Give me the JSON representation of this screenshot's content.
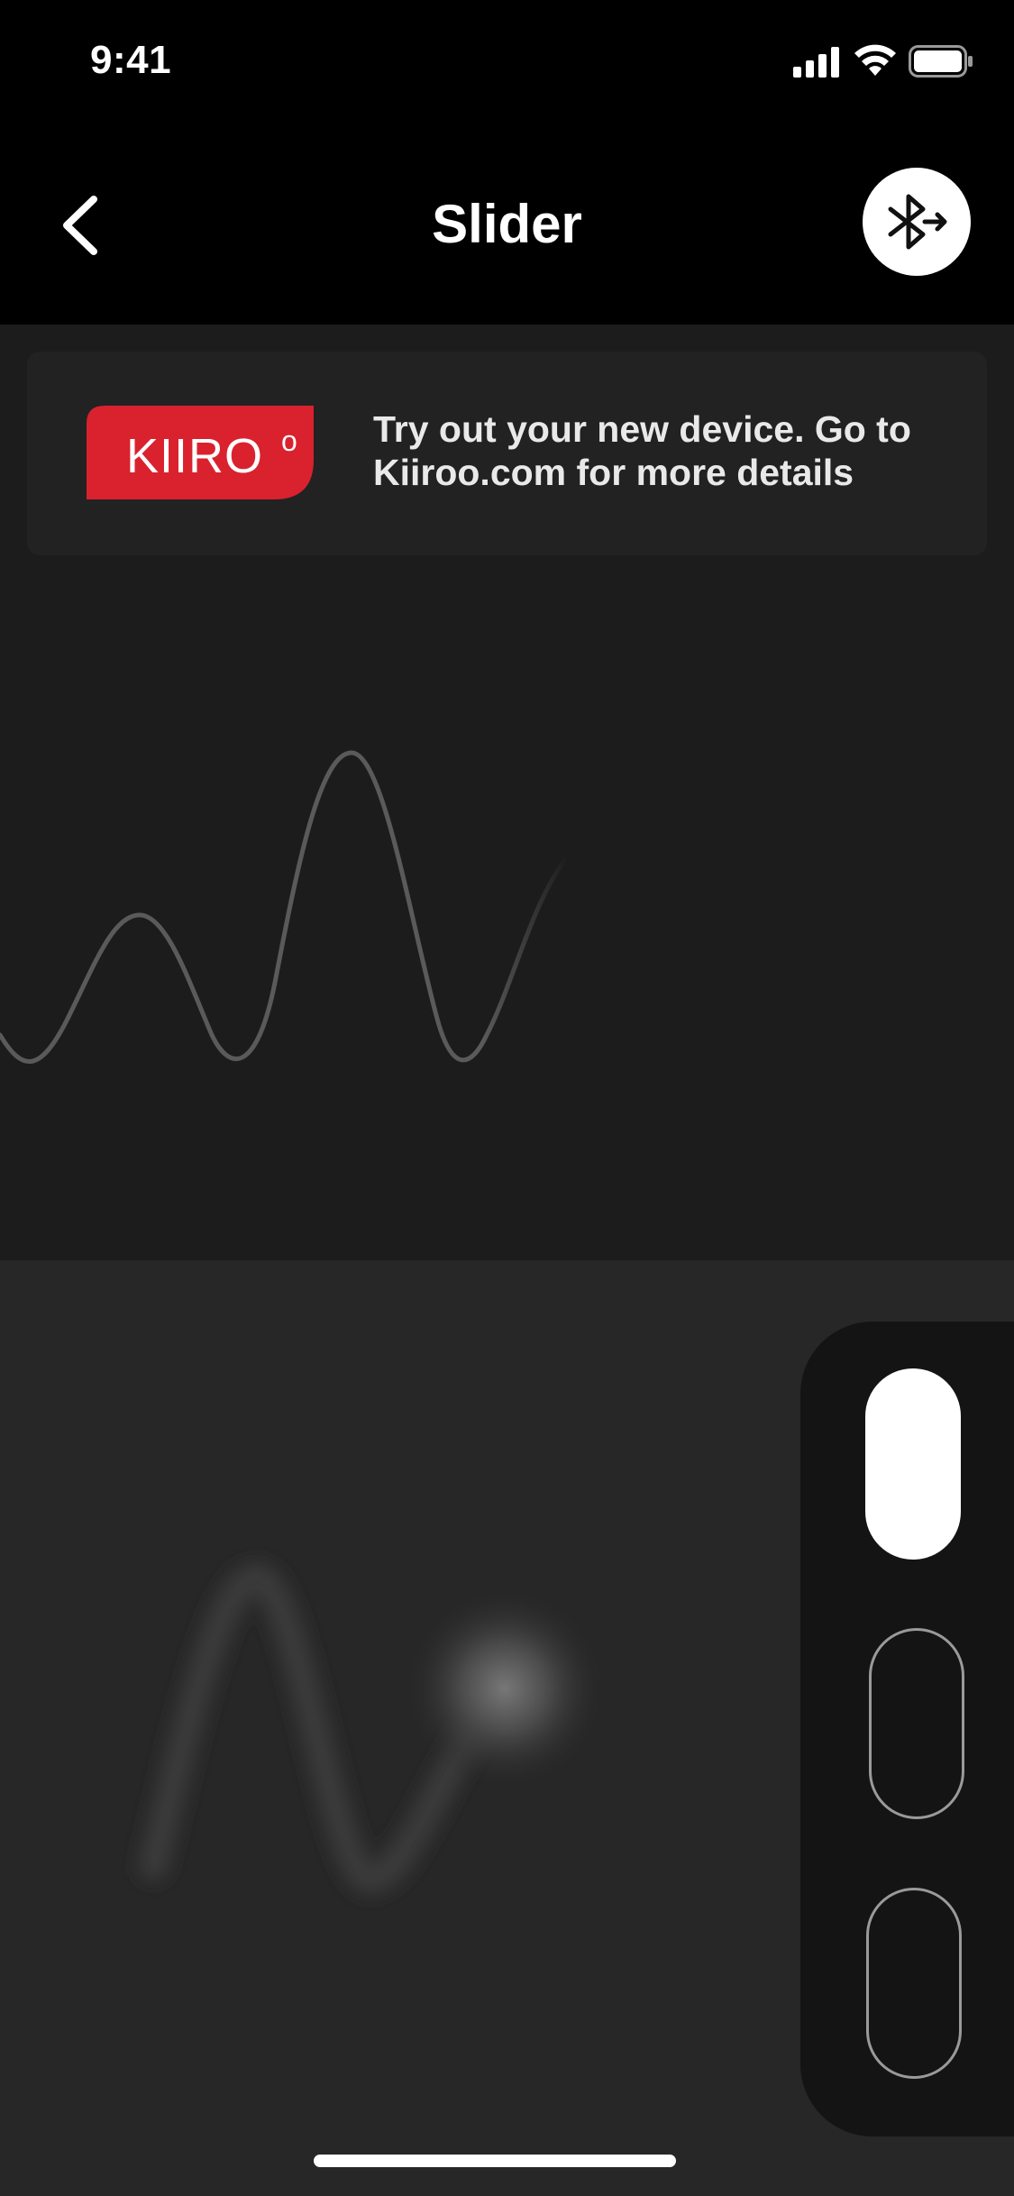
{
  "status_bar": {
    "time": "9:41"
  },
  "nav": {
    "title": "Slider",
    "back_icon": "chevron-left-icon",
    "bluetooth_icon": "bluetooth-arrow-icon"
  },
  "banner": {
    "logo_text": "KIIRO",
    "logo_superscript": "o",
    "message_line1": "Try out your new device. Go to",
    "message_line2": "Kiiroo.com for more details",
    "logo_color": "#d9222e"
  },
  "modes": [
    {
      "name": "mode-1",
      "selected": true
    },
    {
      "name": "mode-2",
      "selected": false
    },
    {
      "name": "mode-3",
      "selected": false
    }
  ],
  "colors": {
    "background": "#000000",
    "wave_area": "#1c1c1c",
    "touch_area": "#272727",
    "wave_line": "#5a5a5a",
    "accent": "#ffffff"
  }
}
